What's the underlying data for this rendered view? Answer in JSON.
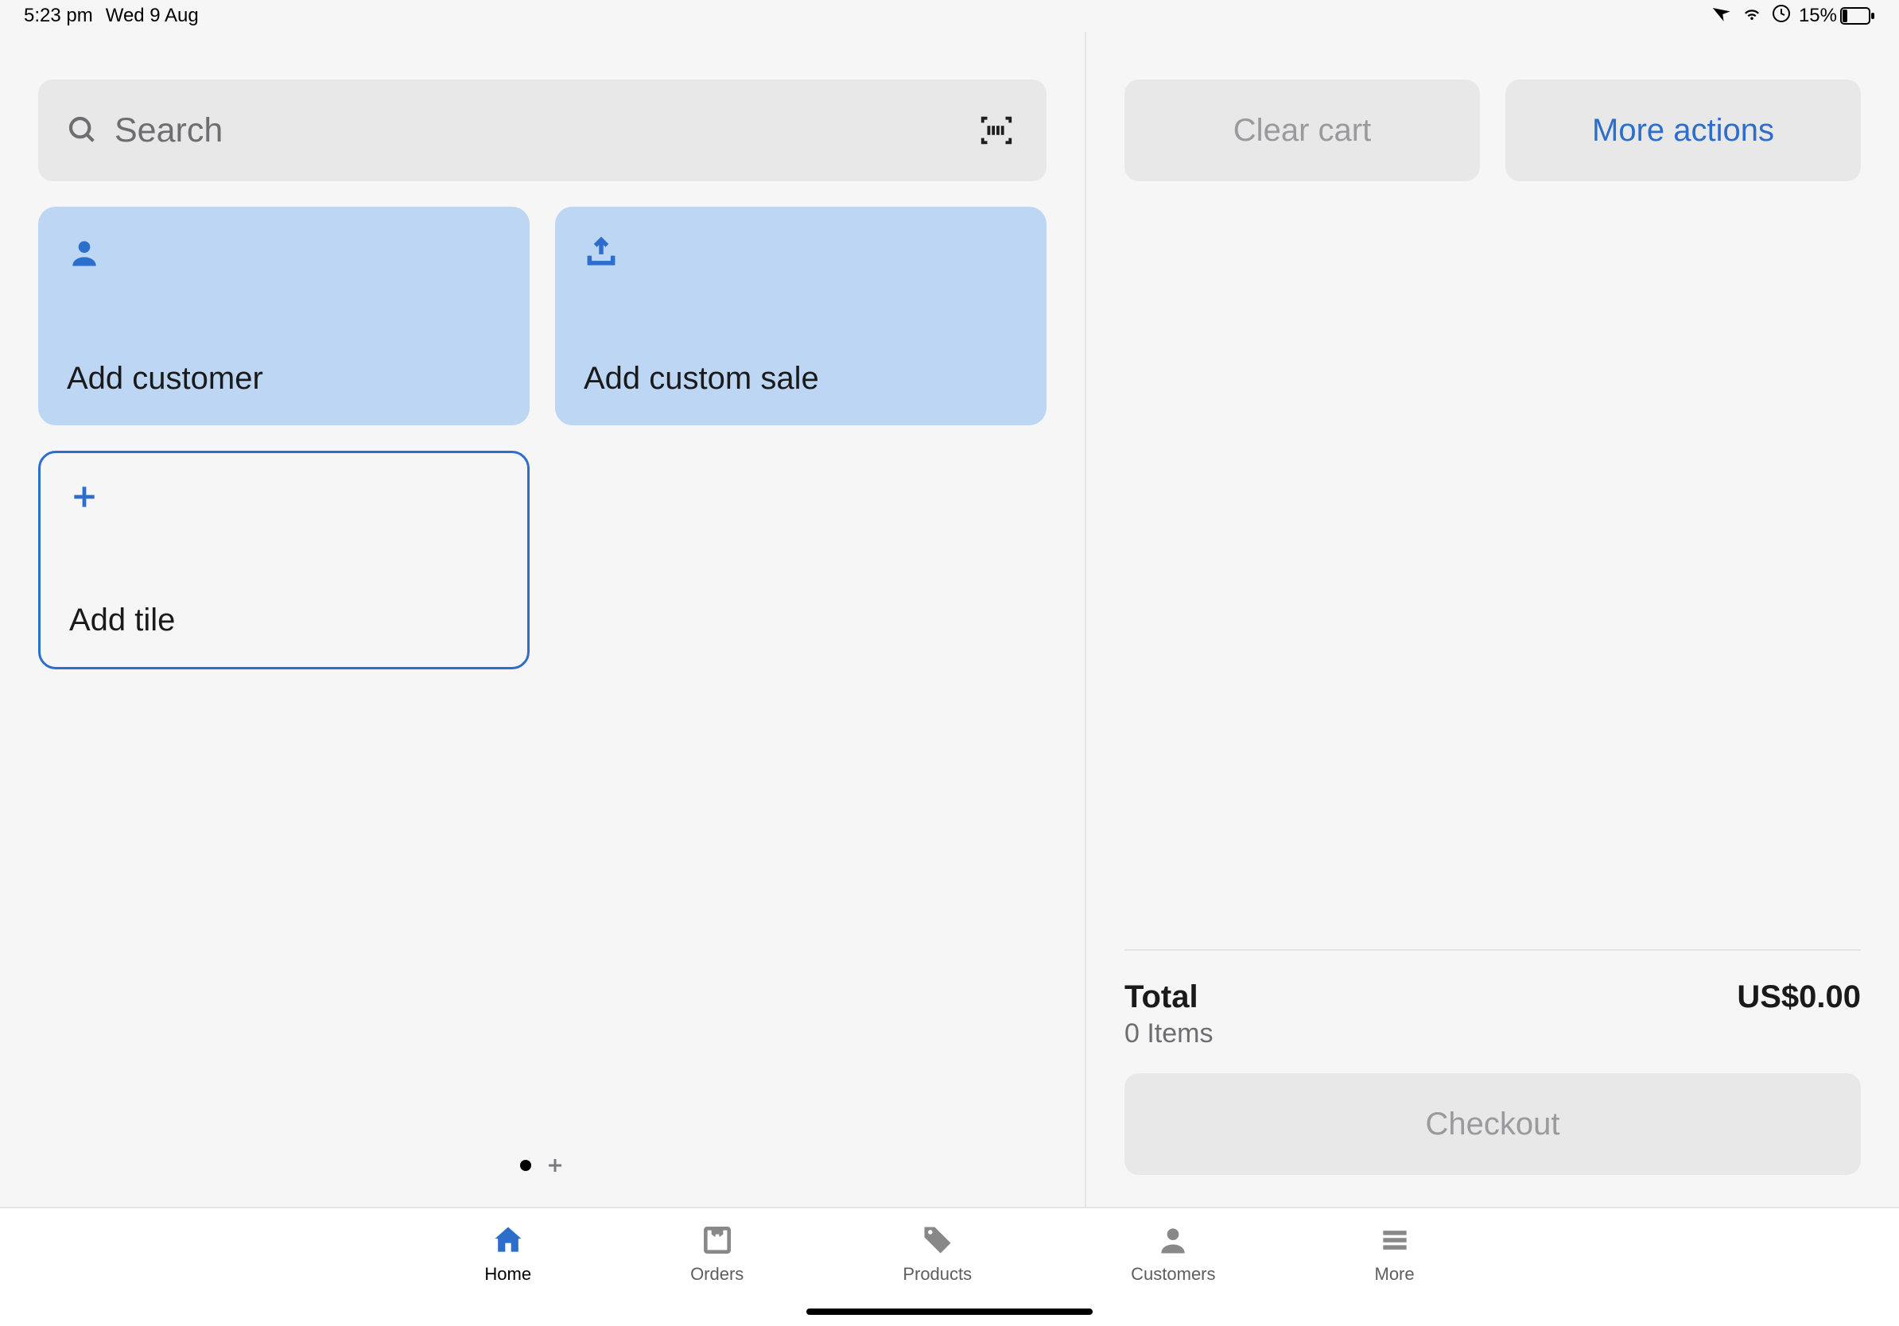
{
  "status_bar": {
    "time": "5:23 pm",
    "date": "Wed 9 Aug",
    "battery_percent": "15%"
  },
  "search": {
    "placeholder": "Search"
  },
  "tiles": {
    "add_customer": "Add customer",
    "add_custom_sale": "Add custom sale",
    "add_tile": "Add tile"
  },
  "cart": {
    "clear_label": "Clear cart",
    "more_label": "More actions",
    "total_label": "Total",
    "items_count": "0 Items",
    "total_amount": "US$0.00",
    "checkout_label": "Checkout"
  },
  "tabs": {
    "home": "Home",
    "orders": "Orders",
    "products": "Products",
    "customers": "Customers",
    "more": "More"
  }
}
